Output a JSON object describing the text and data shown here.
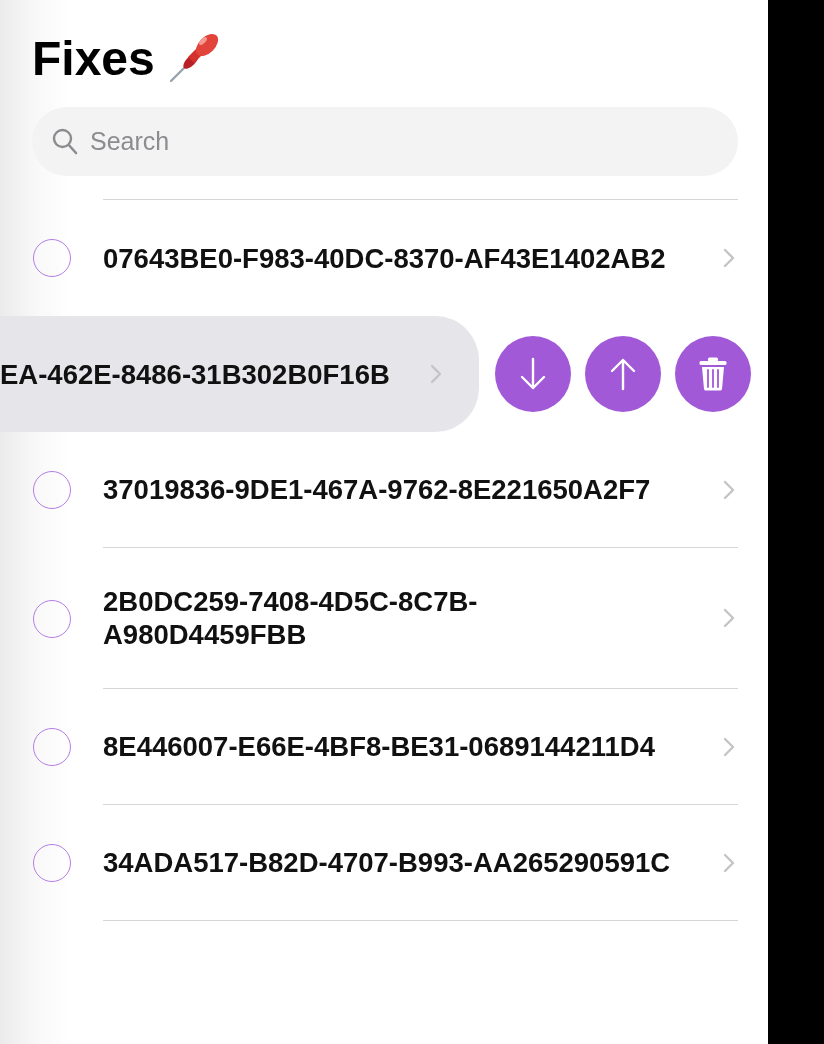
{
  "header": {
    "title": "Fixes"
  },
  "search": {
    "placeholder": "Search"
  },
  "rows": [
    {
      "kind": "plain",
      "text": "07643BE0-F983-40DC-8370-AF43E1402AB2",
      "checked": false
    },
    {
      "kind": "swiped",
      "text": "EA-462E-8486-31B302B0F16B",
      "actions": [
        {
          "kind": "move-down"
        },
        {
          "kind": "move-up"
        },
        {
          "kind": "delete"
        }
      ]
    },
    {
      "kind": "plain",
      "text": "37019836-9DE1-467A-9762-8E221650A2F7",
      "checked": false
    },
    {
      "kind": "plain",
      "text": "2B0DC259-7408-4D5C-8C7B-\nA980D4459FBB",
      "checked": false
    },
    {
      "kind": "plain",
      "text": "8E446007-E66E-4BF8-BE31-0689144211D4",
      "checked": false
    },
    {
      "kind": "plain",
      "text": "34ADA517-B82D-4707-B993-AA265290591C",
      "checked": false
    }
  ]
}
